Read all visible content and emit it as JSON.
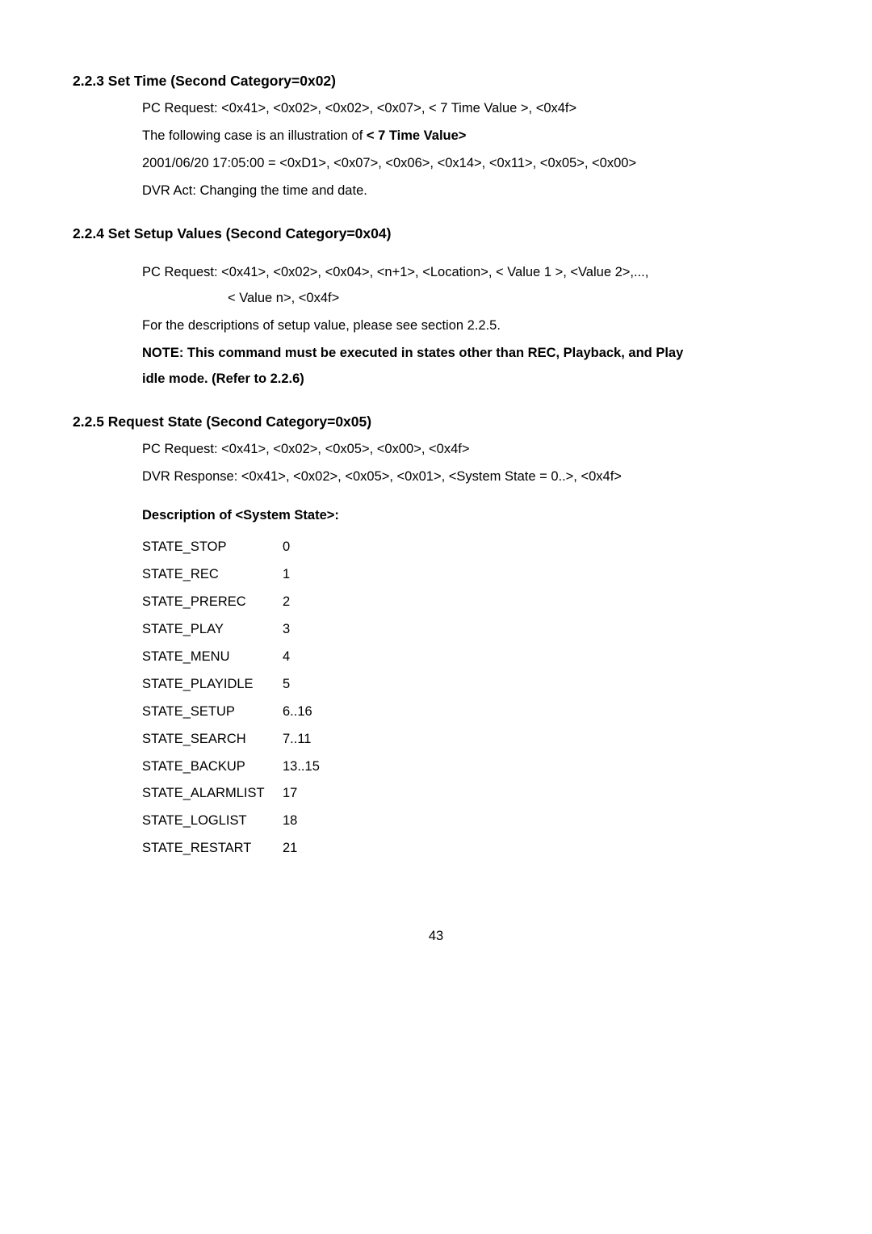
{
  "sec223": {
    "heading": "2.2.3 Set Time (Second Category=0x02)",
    "line1": "PC Request: <0x41>, <0x02>, <0x02>, <0x07>, < 7 Time Value >, <0x4f>",
    "line2a": "The following case is an illustration of ",
    "line2b": "< 7 Time Value>",
    "line3": "2001/06/20 17:05:00 = <0xD1>, <0x07>, <0x06>, <0x14>, <0x11>, <0x05>, <0x00>",
    "line4": "DVR Act: Changing the time and date."
  },
  "sec224": {
    "heading": "2.2.4 Set Setup Values (Second Category=0x04)",
    "line1": "PC Request: <0x41>, <0x02>, <0x04>, <n+1>, <Location>, < Value 1 >, <Value 2>,...,",
    "line1b": "< Value n>, <0x4f>",
    "line2": "For the descriptions of setup value, please see section 2.2.5.",
    "note1": "NOTE: This command must be executed in states other than REC, Playback, and Play",
    "note2": "idle mode. (Refer to 2.2.6)"
  },
  "sec225": {
    "heading": "2.2.5 Request State (Second Category=0x05)",
    "line1": "PC Request: <0x41>, <0x02>, <0x05>, <0x00>, <0x4f>",
    "line2": "DVR Response: <0x41>, <0x02>, <0x05>, <0x01>, <System State = 0..>, <0x4f>",
    "descHeading": "Description of <System State>:",
    "states": [
      {
        "name": "STATE_STOP",
        "val": "0"
      },
      {
        "name": "STATE_REC",
        "val": "1"
      },
      {
        "name": "STATE_PREREC",
        "val": "2"
      },
      {
        "name": "STATE_PLAY",
        "val": "3"
      },
      {
        "name": "STATE_MENU",
        "val": "4"
      },
      {
        "name": "STATE_PLAYIDLE",
        "val": "5"
      },
      {
        "name": "STATE_SETUP",
        "val": "6..16"
      },
      {
        "name": "STATE_SEARCH",
        "val": "7..11"
      },
      {
        "name": "STATE_BACKUP",
        "val": "13..15"
      },
      {
        "name": "STATE_ALARMLIST",
        "val": "17"
      },
      {
        "name": "STATE_LOGLIST",
        "val": "18"
      },
      {
        "name": "STATE_RESTART",
        "val": "21"
      }
    ]
  },
  "pageNumber": "43"
}
